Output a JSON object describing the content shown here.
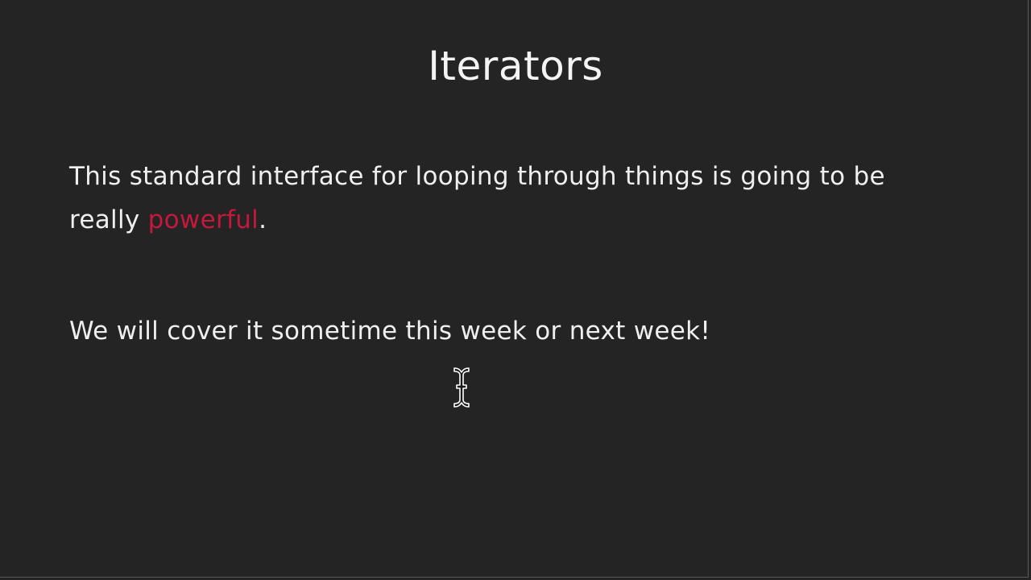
{
  "slide": {
    "title": "Iterators",
    "paragraph_1": {
      "text_before": "This standard interface for looping through things is going to be really ",
      "highlight": "powerful",
      "text_after": "."
    },
    "paragraph_2": "We will cover it sometime this week or next week!"
  },
  "colors": {
    "background": "#242424",
    "text": "#efefef",
    "highlight": "#c4183c"
  },
  "icons": {
    "cursor": "text-ibeam-cursor-icon"
  }
}
